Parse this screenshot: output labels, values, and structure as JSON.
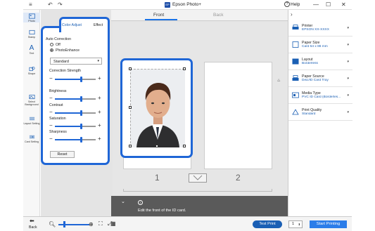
{
  "app": {
    "title": "Epson Photo+",
    "logo_text": "EP",
    "help": "Help"
  },
  "titlebar": {
    "menu_icon": "≡",
    "undo_icon": "↶",
    "redo_icon": "↷",
    "minimize": "—",
    "maximize": "☐",
    "close": "✕"
  },
  "tabs": {
    "front": "Front",
    "back": "Back"
  },
  "left_rail": [
    "Photo",
    "Stamp",
    "Text",
    "Shape",
    "Select Background",
    "Layout Setting",
    "Card Setting"
  ],
  "props": {
    "tab_adjust": "Color Adjust",
    "tab_effect": "Effect",
    "auto_correction": "Auto Correction",
    "opt_off": "Off",
    "opt_photoenhance": "PhotoEnhance",
    "mode_value": "Standard",
    "correction_strength": "Correction Strength",
    "brightness": "Brightness",
    "contrast": "Contrast",
    "saturation": "Saturation",
    "sharpness": "Sharpness",
    "reset": "Reset",
    "levels": {
      "correction_strength": 0.65,
      "brightness": 0.65,
      "contrast": 0.65,
      "saturation": 0.65,
      "sharpness": 0.65
    }
  },
  "card_numbers": {
    "one": "1",
    "two": "2"
  },
  "hint": {
    "text": "Edit the front of the ID card."
  },
  "settings": [
    {
      "title": "Printer",
      "value": "EPSON XX-XXXX"
    },
    {
      "title": "Paper Size",
      "value": "Card 54 x 86 mm"
    },
    {
      "title": "Layout",
      "value": "Borderless"
    },
    {
      "title": "Paper Source",
      "value": "Disc/ID Card Tray"
    },
    {
      "title": "Media Type",
      "value": "PVC ID Card (Borderles..."
    },
    {
      "title": "Print Quality",
      "value": "Standard"
    }
  ],
  "footer": {
    "back": "Back",
    "test_print": "Test Print",
    "copies": "1",
    "start": "Start Printing"
  },
  "colors": {
    "accent": "#1f66d6",
    "button_blue": "#1a73e8"
  }
}
